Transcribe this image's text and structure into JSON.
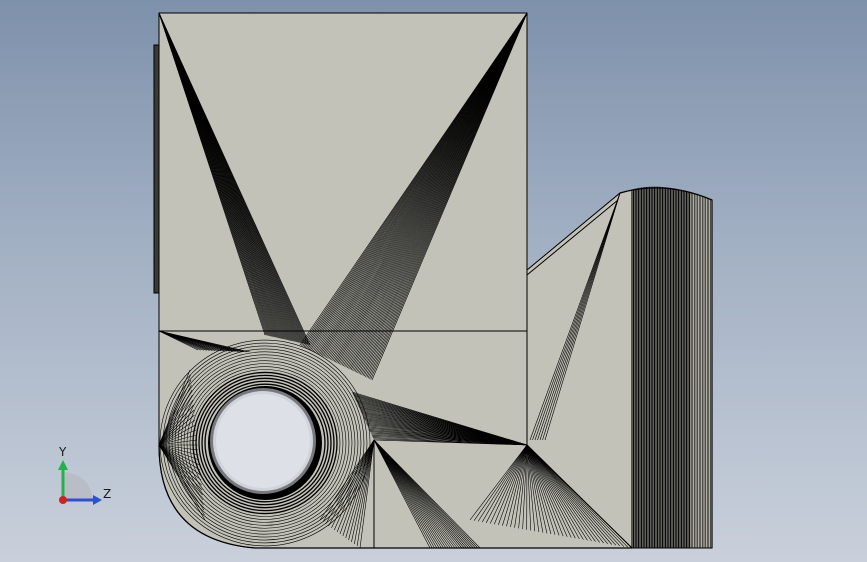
{
  "viewport": {
    "model_face_color": "#c2c2b8",
    "edge_color": "#000000",
    "background_top": "#7e91ab",
    "background_bottom": "#c9d0db"
  },
  "triad": {
    "y_label": "Y",
    "z_label": "Z",
    "y_color": "#22b14c",
    "z_color": "#2e4fd0",
    "x_color": "#d02020"
  }
}
